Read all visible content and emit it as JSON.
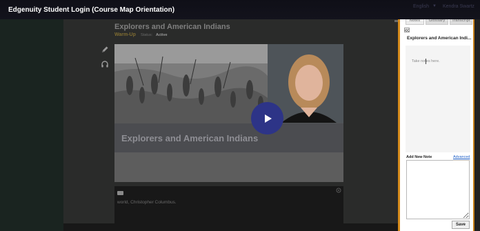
{
  "window": {
    "title": "Edgenuity Student Login (Course Map Orientation)"
  },
  "header": {
    "language": "English",
    "user": "Kendra Swartz"
  },
  "lesson": {
    "title": "Explorers and American Indians",
    "type": "Warm-Up",
    "status_label": "Status:",
    "status_value": "Active"
  },
  "video": {
    "caption": "Explorers and American Indians",
    "play_icon": "play-icon"
  },
  "transcript": {
    "text": "world, Christopher Columbus."
  },
  "notes_panel": {
    "tabs": [
      {
        "label": "Notes"
      },
      {
        "label": "Glossary"
      },
      {
        "label": "Transcript"
      }
    ],
    "title": "Explorers and American Indi...",
    "placeholder": "Take notes here.",
    "add_note_label": "Add New Note",
    "advanced_link": "Advanced",
    "save_label": "Save"
  },
  "colors": {
    "accent_orange": "#d58a1a",
    "play_button": "#2d3487",
    "link_blue": "#1c5ec7"
  }
}
